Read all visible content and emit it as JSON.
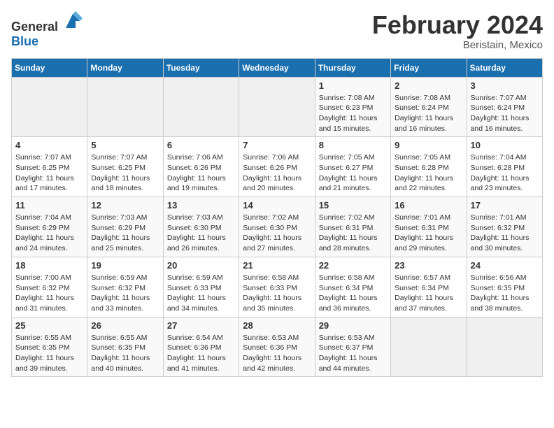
{
  "logo": {
    "general": "General",
    "blue": "Blue"
  },
  "header": {
    "month_year": "February 2024",
    "location": "Beristain, Mexico"
  },
  "weekdays": [
    "Sunday",
    "Monday",
    "Tuesday",
    "Wednesday",
    "Thursday",
    "Friday",
    "Saturday"
  ],
  "weeks": [
    [
      {
        "day": "",
        "info": ""
      },
      {
        "day": "",
        "info": ""
      },
      {
        "day": "",
        "info": ""
      },
      {
        "day": "",
        "info": ""
      },
      {
        "day": "1",
        "info": "Sunrise: 7:08 AM\nSunset: 6:23 PM\nDaylight: 11 hours and 15 minutes."
      },
      {
        "day": "2",
        "info": "Sunrise: 7:08 AM\nSunset: 6:24 PM\nDaylight: 11 hours and 16 minutes."
      },
      {
        "day": "3",
        "info": "Sunrise: 7:07 AM\nSunset: 6:24 PM\nDaylight: 11 hours and 16 minutes."
      }
    ],
    [
      {
        "day": "4",
        "info": "Sunrise: 7:07 AM\nSunset: 6:25 PM\nDaylight: 11 hours and 17 minutes."
      },
      {
        "day": "5",
        "info": "Sunrise: 7:07 AM\nSunset: 6:25 PM\nDaylight: 11 hours and 18 minutes."
      },
      {
        "day": "6",
        "info": "Sunrise: 7:06 AM\nSunset: 6:26 PM\nDaylight: 11 hours and 19 minutes."
      },
      {
        "day": "7",
        "info": "Sunrise: 7:06 AM\nSunset: 6:26 PM\nDaylight: 11 hours and 20 minutes."
      },
      {
        "day": "8",
        "info": "Sunrise: 7:05 AM\nSunset: 6:27 PM\nDaylight: 11 hours and 21 minutes."
      },
      {
        "day": "9",
        "info": "Sunrise: 7:05 AM\nSunset: 6:28 PM\nDaylight: 11 hours and 22 minutes."
      },
      {
        "day": "10",
        "info": "Sunrise: 7:04 AM\nSunset: 6:28 PM\nDaylight: 11 hours and 23 minutes."
      }
    ],
    [
      {
        "day": "11",
        "info": "Sunrise: 7:04 AM\nSunset: 6:29 PM\nDaylight: 11 hours and 24 minutes."
      },
      {
        "day": "12",
        "info": "Sunrise: 7:03 AM\nSunset: 6:29 PM\nDaylight: 11 hours and 25 minutes."
      },
      {
        "day": "13",
        "info": "Sunrise: 7:03 AM\nSunset: 6:30 PM\nDaylight: 11 hours and 26 minutes."
      },
      {
        "day": "14",
        "info": "Sunrise: 7:02 AM\nSunset: 6:30 PM\nDaylight: 11 hours and 27 minutes."
      },
      {
        "day": "15",
        "info": "Sunrise: 7:02 AM\nSunset: 6:31 PM\nDaylight: 11 hours and 28 minutes."
      },
      {
        "day": "16",
        "info": "Sunrise: 7:01 AM\nSunset: 6:31 PM\nDaylight: 11 hours and 29 minutes."
      },
      {
        "day": "17",
        "info": "Sunrise: 7:01 AM\nSunset: 6:32 PM\nDaylight: 11 hours and 30 minutes."
      }
    ],
    [
      {
        "day": "18",
        "info": "Sunrise: 7:00 AM\nSunset: 6:32 PM\nDaylight: 11 hours and 31 minutes."
      },
      {
        "day": "19",
        "info": "Sunrise: 6:59 AM\nSunset: 6:32 PM\nDaylight: 11 hours and 33 minutes."
      },
      {
        "day": "20",
        "info": "Sunrise: 6:59 AM\nSunset: 6:33 PM\nDaylight: 11 hours and 34 minutes."
      },
      {
        "day": "21",
        "info": "Sunrise: 6:58 AM\nSunset: 6:33 PM\nDaylight: 11 hours and 35 minutes."
      },
      {
        "day": "22",
        "info": "Sunrise: 6:58 AM\nSunset: 6:34 PM\nDaylight: 11 hours and 36 minutes."
      },
      {
        "day": "23",
        "info": "Sunrise: 6:57 AM\nSunset: 6:34 PM\nDaylight: 11 hours and 37 minutes."
      },
      {
        "day": "24",
        "info": "Sunrise: 6:56 AM\nSunset: 6:35 PM\nDaylight: 11 hours and 38 minutes."
      }
    ],
    [
      {
        "day": "25",
        "info": "Sunrise: 6:55 AM\nSunset: 6:35 PM\nDaylight: 11 hours and 39 minutes."
      },
      {
        "day": "26",
        "info": "Sunrise: 6:55 AM\nSunset: 6:35 PM\nDaylight: 11 hours and 40 minutes."
      },
      {
        "day": "27",
        "info": "Sunrise: 6:54 AM\nSunset: 6:36 PM\nDaylight: 11 hours and 41 minutes."
      },
      {
        "day": "28",
        "info": "Sunrise: 6:53 AM\nSunset: 6:36 PM\nDaylight: 11 hours and 42 minutes."
      },
      {
        "day": "29",
        "info": "Sunrise: 6:53 AM\nSunset: 6:37 PM\nDaylight: 11 hours and 44 minutes."
      },
      {
        "day": "",
        "info": ""
      },
      {
        "day": "",
        "info": ""
      }
    ]
  ]
}
